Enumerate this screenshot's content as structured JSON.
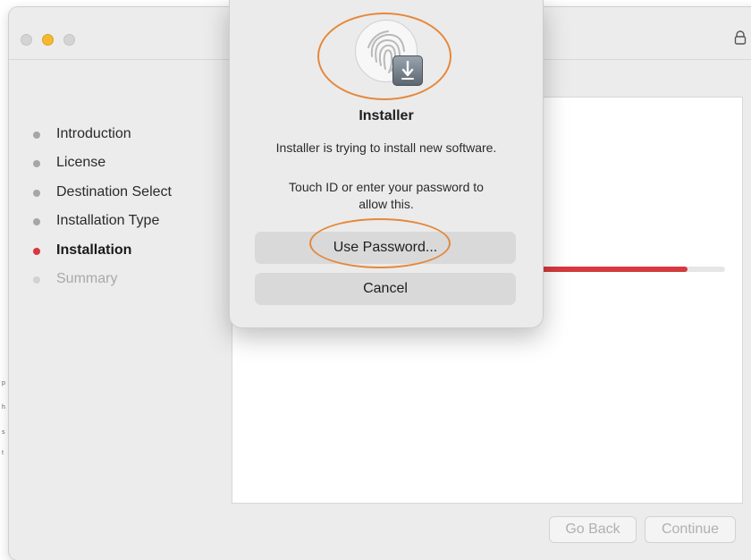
{
  "window": {
    "title_bar": {
      "traffic_lights": [
        "close",
        "minimize",
        "zoom"
      ],
      "lock_icon": "lock-icon"
    }
  },
  "sidebar": {
    "steps": [
      {
        "label": "Introduction",
        "state": "done"
      },
      {
        "label": "License",
        "state": "done"
      },
      {
        "label": "Destination Select",
        "state": "done"
      },
      {
        "label": "Installation Type",
        "state": "done"
      },
      {
        "label": "Installation",
        "state": "active"
      },
      {
        "label": "Summary",
        "state": "future"
      }
    ]
  },
  "main": {
    "progress_fraction": 0.92,
    "progress_color": "#d43a3f"
  },
  "footer": {
    "go_back_label": "Go Back",
    "continue_label": "Continue"
  },
  "dialog": {
    "icon": "touch-id-fingerprint-icon",
    "badge_icon": "installer-package-icon",
    "title": "Installer",
    "message": "Installer is trying to install new software.",
    "sub_message": "Touch ID or enter your password to allow this.",
    "use_password_label": "Use Password...",
    "cancel_label": "Cancel"
  },
  "colors": {
    "accent_red": "#d9363e",
    "annotation_orange": "#e5883b",
    "minimize_yellow": "#f5b82e"
  }
}
